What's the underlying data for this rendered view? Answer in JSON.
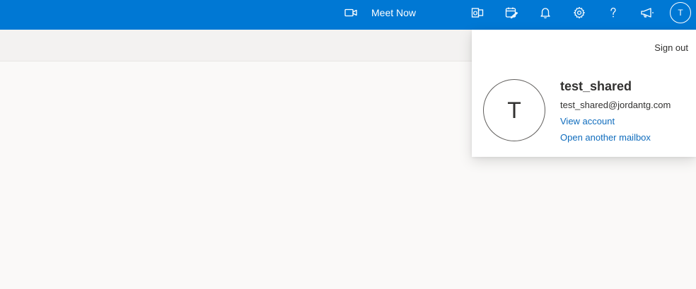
{
  "topbar": {
    "meet_now_label": "Meet Now",
    "icons": [
      "video-camera-icon",
      "office-apps-icon",
      "my-day-icon",
      "bell-icon",
      "gear-icon",
      "help-icon",
      "megaphone-icon"
    ],
    "avatar_initial": "T",
    "accent_color": "#0078d4"
  },
  "account": {
    "sign_out": "Sign out",
    "avatar_initial": "T",
    "display_name": "test_shared",
    "email": "test_shared@jordantg.com",
    "view_account": "View account",
    "open_another_mailbox": "Open another mailbox"
  }
}
